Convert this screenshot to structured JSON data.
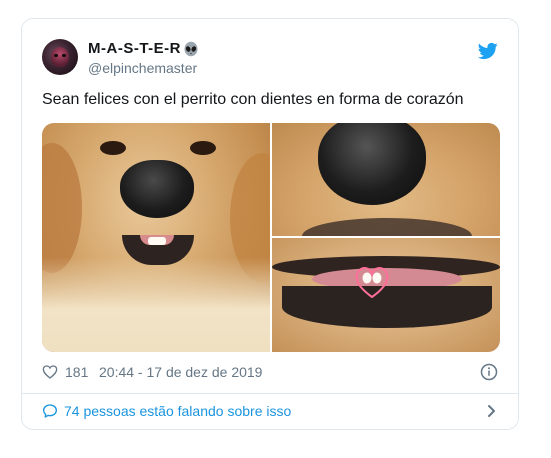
{
  "tweet": {
    "author": {
      "display_name": "M-A-S-T-E-R",
      "name_emoji": "alien-icon",
      "handle": "@elpinchemaster"
    },
    "text": "Sean felices con el perrito con dientes en forma de corazón",
    "likes": "181",
    "timestamp": "20:44 - 17 de dez de 2019",
    "conversation_label": "74 pessoas estão falando sobre isso"
  },
  "icons": {
    "brand": "twitter-bird-icon",
    "like": "heart-outline-icon",
    "info": "info-icon",
    "conversation": "speech-bubble-icon",
    "chevron": "chevron-right-icon"
  },
  "colors": {
    "accent": "#1da1f2",
    "link": "#1b95e0",
    "text": "#14171a",
    "muted": "#657786",
    "border": "#e1e8ed"
  }
}
